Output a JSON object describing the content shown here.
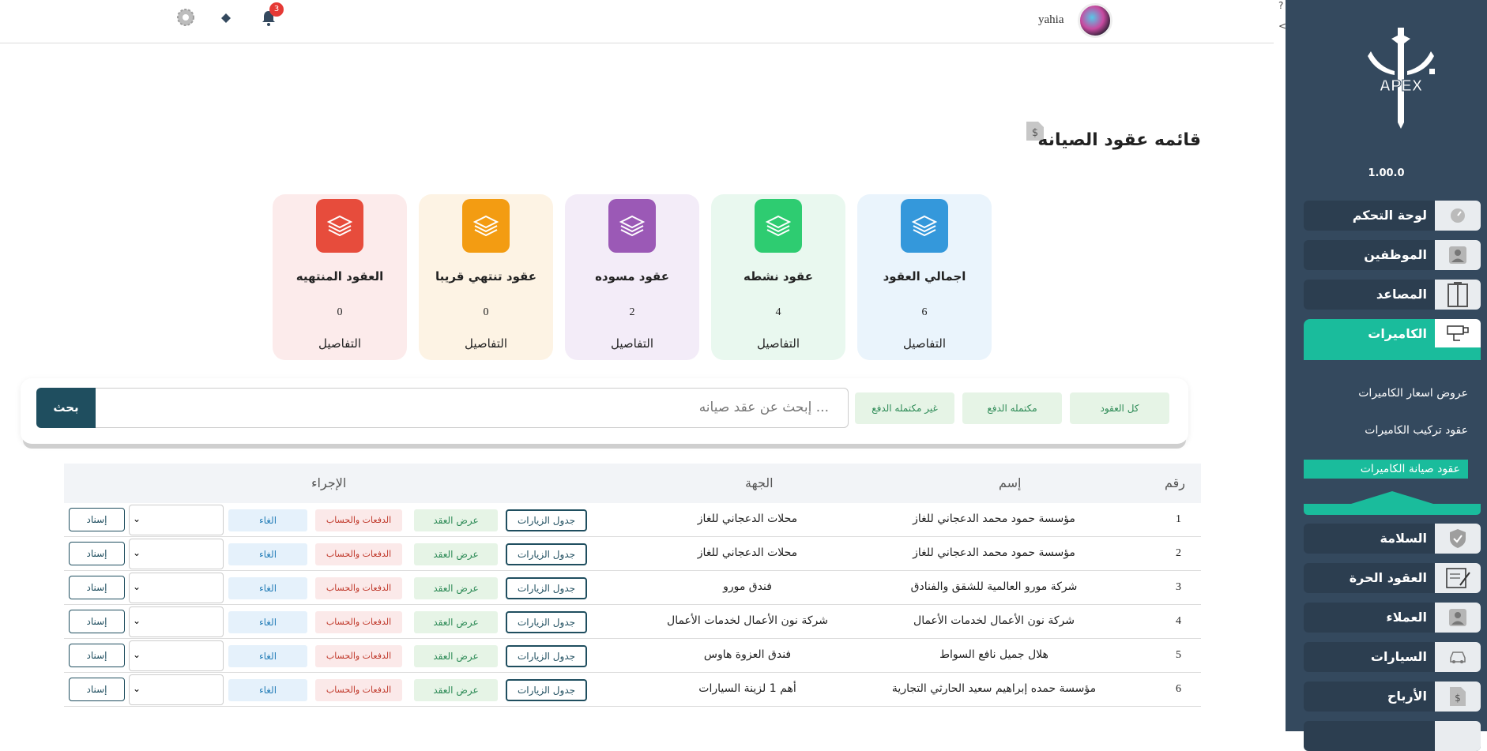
{
  "header": {
    "username": "yahia",
    "notifications_count": "3",
    "edge_marks": [
      "?",
      "<"
    ]
  },
  "sidebar": {
    "version": "1.00.0",
    "items": [
      {
        "label": "لوحة التحكم",
        "icon": "dashboard-icon"
      },
      {
        "label": "الموظفين",
        "icon": "user-icon"
      },
      {
        "label": "المصاعد",
        "icon": "elevator-icon"
      },
      {
        "label": "الكاميرات",
        "icon": "camera-icon"
      },
      {
        "label": "السلامة",
        "icon": "shield-icon"
      },
      {
        "label": "العقود الحرة",
        "icon": "contract-icon"
      },
      {
        "label": "العملاء",
        "icon": "client-icon"
      },
      {
        "label": "السيارات",
        "icon": "car-icon"
      },
      {
        "label": "الأرباح",
        "icon": "money-icon"
      }
    ],
    "sub_items": [
      "عروض اسعار الكاميرات",
      "عقود تركيب الكاميرات",
      "عقود صيانة الكاميرات"
    ]
  },
  "page": {
    "title": "قائمه عقود الصيانه"
  },
  "cards": [
    {
      "title": "اجمالي العقود",
      "count": "6",
      "link": "التفاصيل",
      "color": "#3498db",
      "bg": "#eaf4fc"
    },
    {
      "title": "عقود نشطه",
      "count": "4",
      "link": "التفاصيل",
      "color": "#2ecc71",
      "bg": "#e9f8ef"
    },
    {
      "title": "عقود مسوده",
      "count": "2",
      "link": "التفاصيل",
      "color": "#9b59b6",
      "bg": "#f3ecf8"
    },
    {
      "title": "عقود تنتهي قريبا",
      "count": "0",
      "link": "التفاصيل",
      "color": "#f39c12",
      "bg": "#fdf3e4"
    },
    {
      "title": "العقود المنتهيه",
      "count": "0",
      "link": "التفاصيل",
      "color": "#e74c3c",
      "bg": "#fcebeb"
    }
  ],
  "filters": {
    "all": "كل العقود",
    "paid": "مكتمله الدفع",
    "unpaid": "غير مكتمله الدفع"
  },
  "search": {
    "placeholder": "إبحث عن  عقد صيانه ...",
    "button": "بحث"
  },
  "table": {
    "headers": {
      "num": "رقم",
      "name": "إسم",
      "dept": "الجهة",
      "action": "الإجراء"
    },
    "action_labels": {
      "visits": "جدول الزيارات",
      "view": "عرض العقد",
      "payments": "الدفعات والحساب",
      "cancel": "الغاء",
      "assign": "إسناد"
    },
    "rows": [
      {
        "num": "1",
        "name": "مؤسسة حمود محمد الدعجاني للغاز",
        "dept": "محلات الدعجاني للغاز"
      },
      {
        "num": "2",
        "name": "مؤسسة حمود محمد الدعجاني للغاز",
        "dept": "محلات الدعجاني للغاز"
      },
      {
        "num": "3",
        "name": "شركة مورو العالمية للشقق والفنادق",
        "dept": "فندق مورو"
      },
      {
        "num": "4",
        "name": "شركة نون الأعمال لخدمات الأعمال",
        "dept": "شركة نون الأعمال لخدمات الأعمال"
      },
      {
        "num": "5",
        "name": "هلال جميل نافع السواط",
        "dept": "فندق العزوة هاوس"
      },
      {
        "num": "6",
        "name": "مؤسسة حمده إبراهيم سعيد الحارثي التجارية",
        "dept": "أهم 1 لزينة السيارات"
      }
    ]
  }
}
